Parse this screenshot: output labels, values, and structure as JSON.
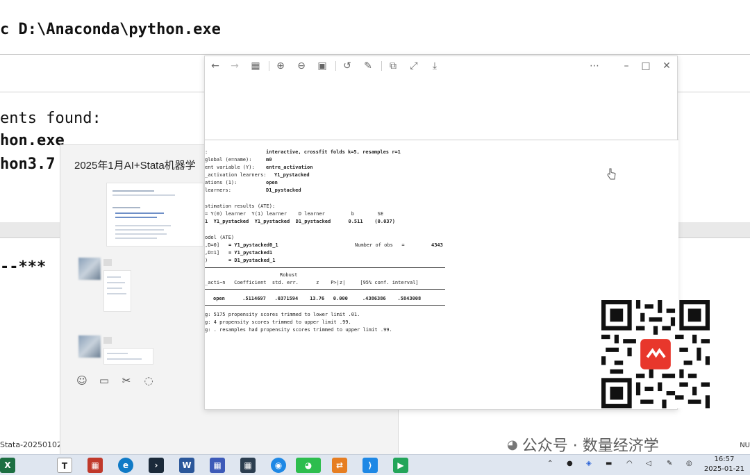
{
  "terminal": {
    "line1": "c D:\\Anaconda\\python.exe",
    "line2": "ents found:",
    "line3": "hon.exe",
    "line4": "hon3.7",
    "line5": "--***",
    "taskpath": "Stata-20250102\\"
  },
  "chat": {
    "title": "2025年1月AI+Stata机器学",
    "tools": [
      "smiley-icon",
      "folder-icon",
      "scissors-icon",
      "chat-bubble-icon"
    ]
  },
  "viewer": {
    "toolbar": [
      "back-icon",
      "forward-icon",
      "grid-icon",
      "zoom-in-icon",
      "zoom-out-icon",
      "fit-icon",
      "rotate-icon",
      "edit-icon",
      "copy-icon",
      "fullscreen-icon",
      "save-icon",
      "more-icon",
      "minimize-icon",
      "maximize-icon",
      "close-icon"
    ],
    "output": {
      "l1_label": ":",
      "l1_value": "interactive, crossfit folds k=5, resamples r=1",
      "l2_label": "global (e=name):",
      "l2_value": "m0",
      "l3_label": "ent variable (Y):",
      "l3_value": "entre_activation",
      "l4_label": "_activation learners:",
      "l4_value": "Y1_pystacked",
      "l5_label": "ations (1):",
      "l5_value": "open",
      "l6_label": "learners:",
      "l6_value": "D1_pystacked",
      "est_head": "stimation results (ATE):",
      "est_cols": "= Y(0) learner  Y(1) learner    D learner         b        SE",
      "est_row": "1  Y1_pystacked  Y1_pystacked  D1_pystacked      0.511    (0.037)",
      "model_head": "odel (ATE)",
      "m1_label": ",D=0]",
      "m1_value": "= Y1_pystacked0_1",
      "obs_label": "Number of obs   =",
      "obs_value": "4343",
      "m2_label": ",D=1]",
      "m2_value": "= Y1_pystacked1",
      "m3_label": ")",
      "m3_value": "= D1_pystacked_1",
      "robust": "Robust",
      "tbl_head": "_acti~n   Coefficient  std. err.      z    P>|z|     [95% conf. interval]",
      "tbl_row": "open      .5114697   .0371594    13.76   0.000     .4386386    .5843008",
      "note1": "g: 5175 propensity scores trimmed to lower limit .01.",
      "note2": "g: 4 propensity scores trimmed to upper limit .99.",
      "note3": "g: . resamples had propensity scores trimmed to upper limit .99."
    }
  },
  "watermark": {
    "text": "公众号 · 数量经济学"
  },
  "taskbar": {
    "time": "16:57",
    "date": "2025-01-21",
    "nu": "NU",
    "icons": [
      {
        "name": "excel-icon",
        "label": "",
        "color": "#1d6f42"
      },
      {
        "name": "typora-icon",
        "label": "T",
        "color": "#ffffff"
      },
      {
        "name": "sheet-icon",
        "label": "",
        "color": "#c0392b"
      },
      {
        "name": "edge-icon",
        "label": "",
        "color": "#0f7ac6"
      },
      {
        "name": "terminal-icon",
        "label": "",
        "color": "#1b2a3a"
      },
      {
        "name": "word-icon",
        "label": "",
        "color": "#2b579a"
      },
      {
        "name": "grid-app-icon",
        "label": "",
        "color": "#3d5ab8"
      },
      {
        "name": "calculator-icon",
        "label": "",
        "color": "#2c3e50"
      },
      {
        "name": "browser-icon",
        "label": "",
        "color": "#1e88e5"
      },
      {
        "name": "wechat-icon",
        "label": "",
        "color": "#2dbd4e"
      },
      {
        "name": "sync-icon",
        "label": "",
        "color": "#e67e22"
      },
      {
        "name": "vscode-icon",
        "label": "",
        "color": "#1e88e5"
      },
      {
        "name": "media-icon",
        "label": "",
        "color": "#23a55a"
      }
    ],
    "tray": [
      "chevron-up-icon",
      "mic-icon",
      "shield-icon",
      "battery-icon",
      "wifi-icon",
      "volume-icon",
      "pen-icon",
      "network-icon"
    ]
  }
}
